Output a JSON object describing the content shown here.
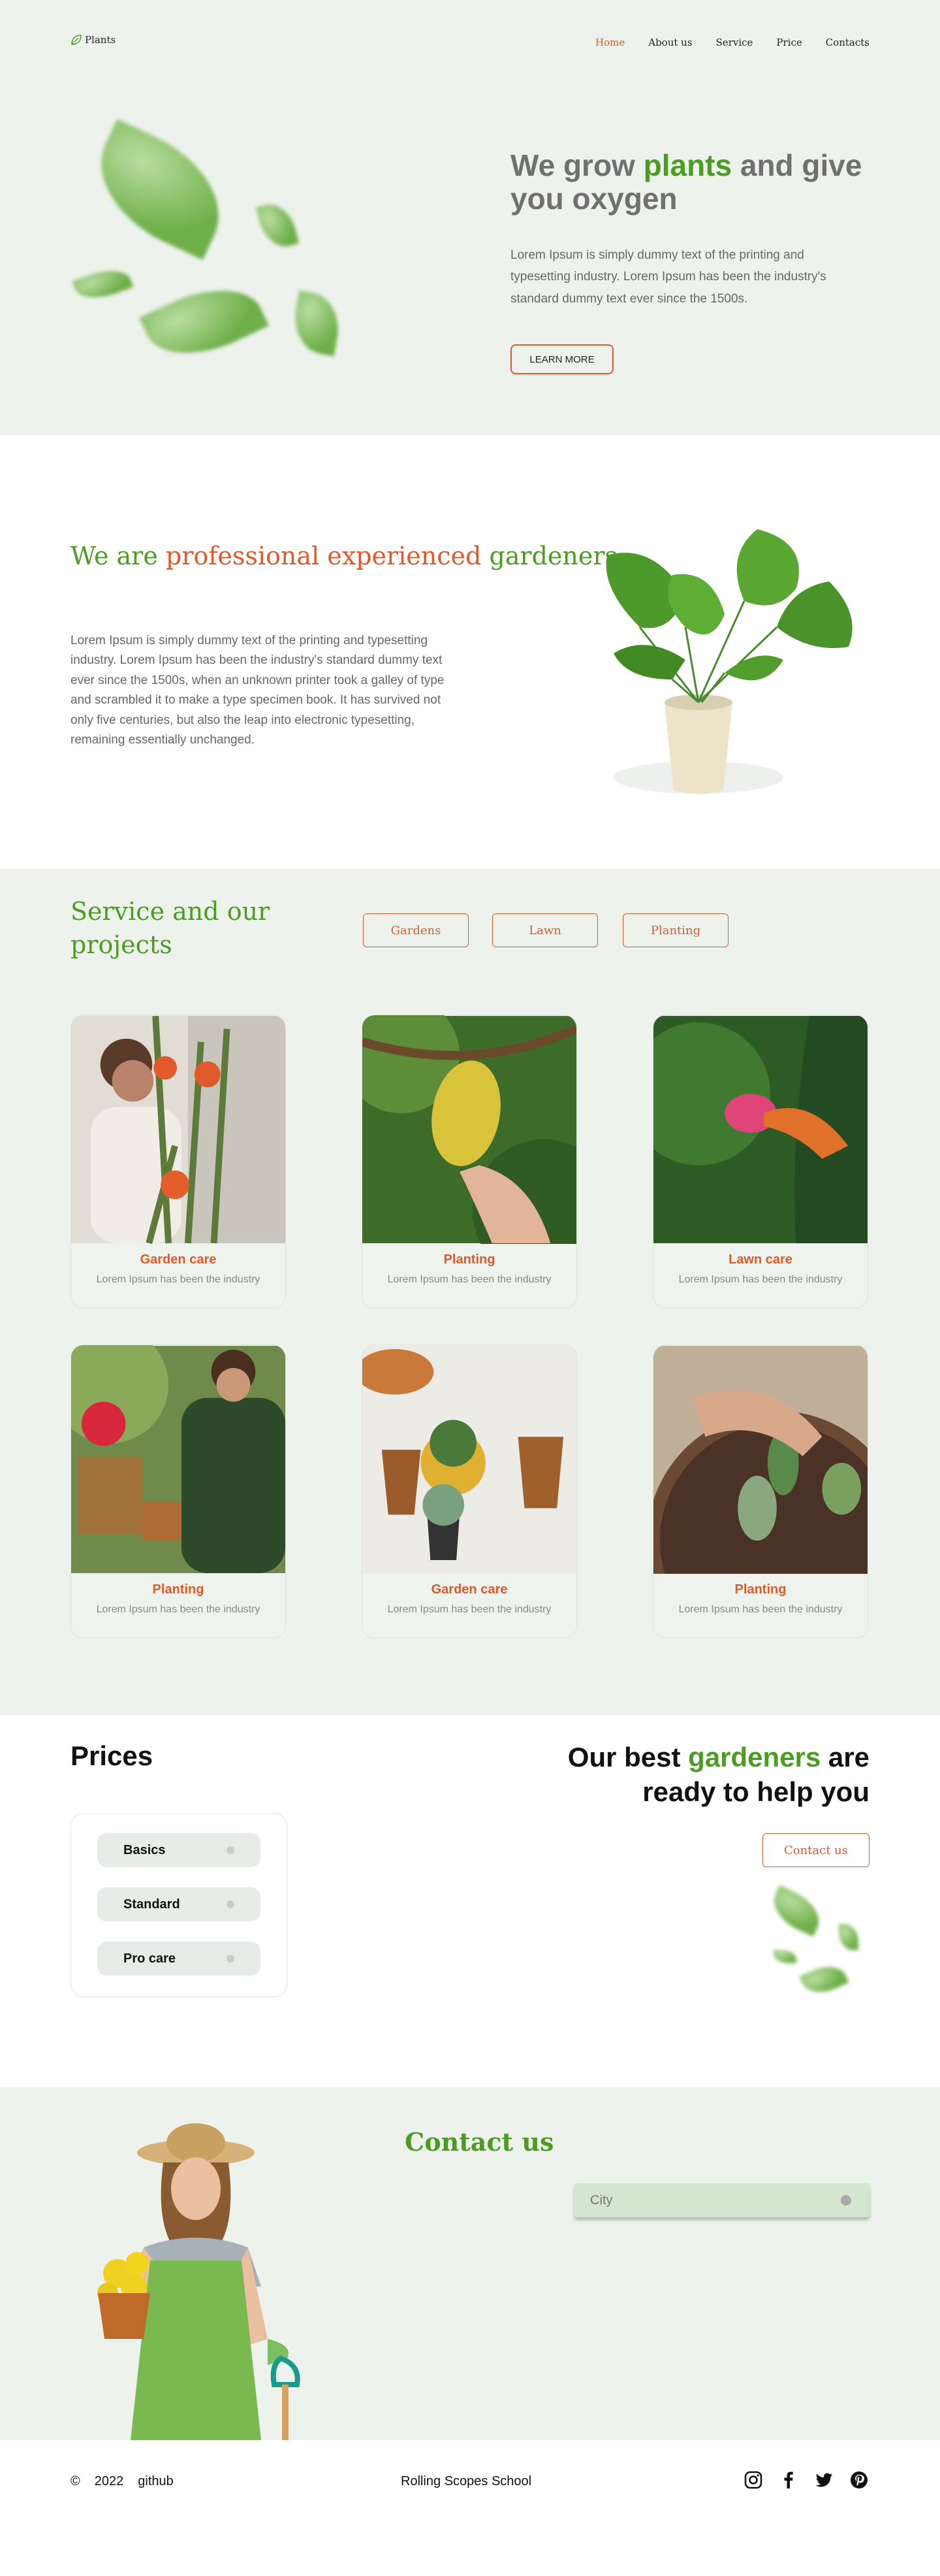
{
  "header": {
    "logo_text": "Plants",
    "nav": [
      "Home",
      "About us",
      "Service",
      "Price",
      "Contacts"
    ],
    "active_nav": "Home"
  },
  "hero": {
    "title_part1": "We grow ",
    "title_highlight": "plants",
    "title_part2": " and give you oxygen",
    "text": "Lorem Ipsum is simply dummy text of the printing and typesetting industry. Lorem Ipsum has been the industry's standard dummy text ever since the 1500s.",
    "button": "LEARN MORE"
  },
  "about": {
    "title_part1": "We are ",
    "title_highlight": "professional experienced",
    "title_part2": " gardeners",
    "text": "Lorem Ipsum is simply dummy text of the printing and typesetting industry. Lorem Ipsum has been the industry's standard dummy text ever since the 1500s, when an unknown printer took a galley of type and scrambled it to make a type specimen book. It has survived not only five centuries, but also the leap into electronic typesetting, remaining essentially unchanged."
  },
  "services": {
    "title": "Service and our projects",
    "filters": [
      "Gardens",
      "Lawn",
      "Planting"
    ],
    "cards": [
      {
        "title": "Garden care",
        "desc": "Lorem Ipsum has been the industry"
      },
      {
        "title": "Planting",
        "desc": "Lorem Ipsum has been the industry"
      },
      {
        "title": "Lawn care",
        "desc": "Lorem Ipsum has been the industry"
      },
      {
        "title": "Planting",
        "desc": "Lorem Ipsum has been the industry"
      },
      {
        "title": "Garden care",
        "desc": "Lorem Ipsum has been the industry"
      },
      {
        "title": "Planting",
        "desc": "Lorem Ipsum has been the industry"
      }
    ]
  },
  "prices": {
    "title": "Prices",
    "items": [
      "Basics",
      "Standard",
      "Pro care"
    ]
  },
  "best": {
    "part1": "Our best ",
    "highlight": "gardeners",
    "part2": " are ready to help you",
    "button": "Contact us"
  },
  "contact": {
    "title": "Contact us",
    "city_placeholder": "City"
  },
  "footer": {
    "copyright": "©",
    "year": "2022",
    "github": "github",
    "school": "Rolling Scopes School",
    "social_icons": [
      "instagram-icon",
      "facebook-icon",
      "twitter-icon",
      "pinterest-icon"
    ]
  },
  "colors": {
    "accent_green": "#4a9d20",
    "accent_orange": "#e0592a",
    "section_bg": "#edf2ec"
  }
}
